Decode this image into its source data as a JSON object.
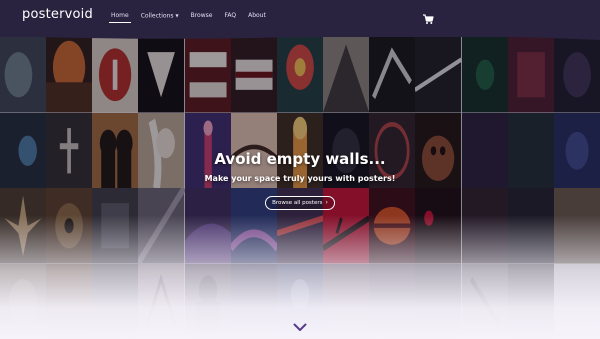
{
  "brand": {
    "logo_text_a": "poster",
    "logo_text_b": "void",
    "logo_mark": "o"
  },
  "nav": {
    "links": [
      {
        "label": "Home",
        "active": true
      },
      {
        "label": "Collections",
        "has_dropdown": true
      },
      {
        "label": "Browse"
      },
      {
        "label": "FAQ"
      },
      {
        "label": "About"
      }
    ],
    "cart_icon": "cart-icon"
  },
  "hero": {
    "title": "Avoid empty walls...",
    "subtitle": "Make your space truly yours with posters!",
    "cta_label": "Browse all posters",
    "cta_icon": "chevron-right-icon",
    "scroll_icon": "chevron-down-icon"
  },
  "colors": {
    "nav_bg": "#29233f",
    "accent": "#5a3d8a",
    "page_bg": "#f6f3fb"
  }
}
